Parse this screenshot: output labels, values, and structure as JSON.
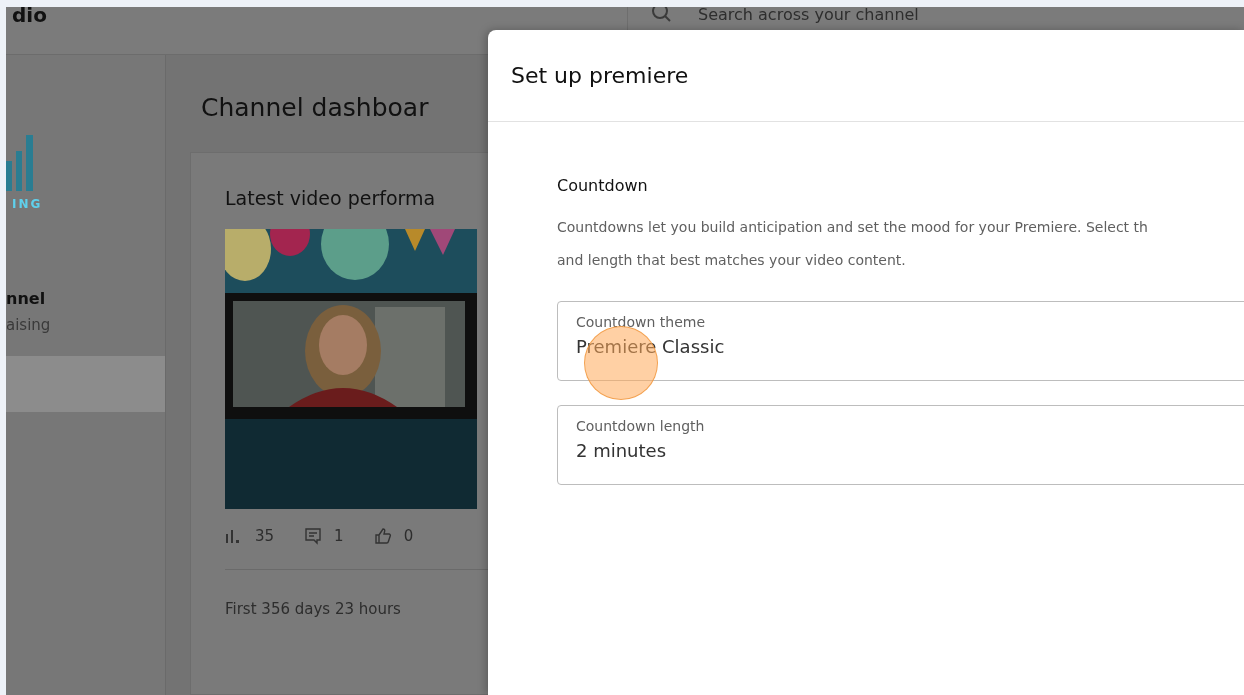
{
  "header": {
    "logo_text": "dio",
    "search": {
      "placeholder": "Search across your channel"
    }
  },
  "sidebar": {
    "logo_caption": "ING",
    "channel_name": "nnel",
    "channel_subtitle": "aising",
    "items": [
      {
        "selected": true
      }
    ]
  },
  "main": {
    "title": "Channel dashboar",
    "card": {
      "title": "Latest video performa",
      "stats": [
        {
          "kind": "views",
          "value": "35"
        },
        {
          "kind": "comments",
          "value": "1"
        },
        {
          "kind": "likes",
          "value": "0"
        }
      ],
      "footer": "First 356 days 23 hours"
    }
  },
  "dialog": {
    "title": "Set up premiere",
    "section_title": "Countdown",
    "description_lines": [
      "Countdowns let you build anticipation and set the mood for your Premiere. Select th",
      "and length that best matches your video content."
    ],
    "fields": [
      {
        "label": "Countdown theme",
        "value": "Premiere Classic"
      },
      {
        "label": "Countdown length",
        "value": "2 minutes"
      }
    ]
  }
}
